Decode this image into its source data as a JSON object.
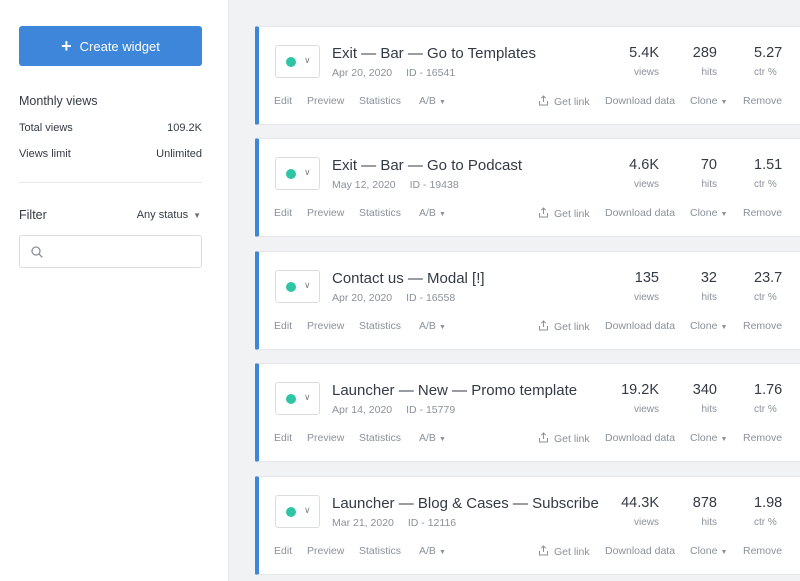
{
  "sidebar": {
    "create_label": "Create widget",
    "monthly_views_title": "Monthly views",
    "stats": [
      {
        "label": "Total views",
        "value": "109.2K"
      },
      {
        "label": "Views limit",
        "value": "Unlimited"
      }
    ],
    "filter_label": "Filter",
    "status_filter": "Any status",
    "search_placeholder": ""
  },
  "actions": {
    "edit": "Edit",
    "preview": "Preview",
    "statistics": "Statistics",
    "ab": "A/B",
    "get_link": "Get link",
    "download": "Download data",
    "clone": "Clone",
    "remove": "Remove"
  },
  "metric_labels": {
    "views": "views",
    "hits": "hits",
    "ctr": "ctr %"
  },
  "colors": {
    "accent": "#3e86d9",
    "status_active": "#2ec4a6"
  },
  "widgets": [
    {
      "name": "Exit — Bar — Go to Templates",
      "date": "Apr 20, 2020",
      "id": "ID - 16541",
      "views": "5.4K",
      "hits": "289",
      "ctr": "5.27"
    },
    {
      "name": "Exit — Bar — Go to Podcast",
      "date": "May 12, 2020",
      "id": "ID - 19438",
      "views": "4.6K",
      "hits": "70",
      "ctr": "1.51"
    },
    {
      "name": "Contact us — Modal [!]",
      "date": "Apr 20, 2020",
      "id": "ID - 16558",
      "views": "135",
      "hits": "32",
      "ctr": "23.7"
    },
    {
      "name": "Launcher — New — Promo template",
      "date": "Apr 14, 2020",
      "id": "ID - 15779",
      "views": "19.2K",
      "hits": "340",
      "ctr": "1.76"
    },
    {
      "name": "Launcher — Blog & Cases — Subscribe",
      "date": "Mar 21, 2020",
      "id": "ID - 12116",
      "views": "44.3K",
      "hits": "878",
      "ctr": "1.98"
    }
  ]
}
